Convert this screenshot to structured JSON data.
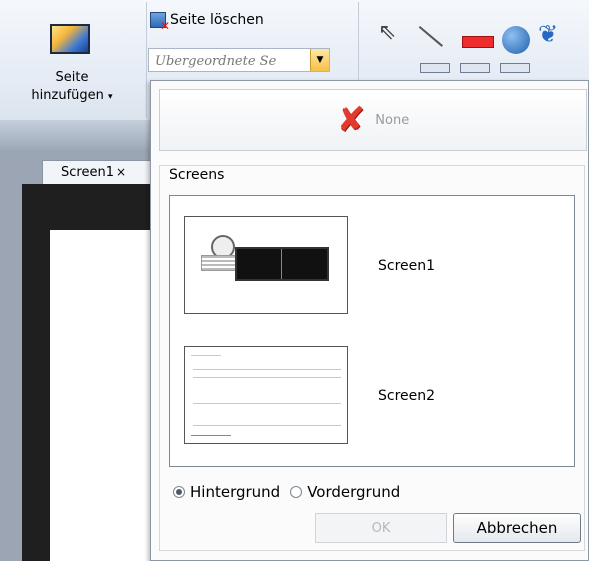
{
  "ribbon": {
    "add_page_line1": "Seite",
    "add_page_line2": "hinzufügen",
    "add_page_caret": "▾",
    "delete_page_label": "Seite löschen",
    "parent_page_value": "Übergeordnete Se"
  },
  "document": {
    "tab_label": "Screen1",
    "tab_close": "×"
  },
  "panel": {
    "none_label": "None",
    "group_label": "Screens",
    "screens": [
      {
        "name": "Screen1"
      },
      {
        "name": "Screen2"
      }
    ],
    "layer_options": [
      {
        "label": "Hintergrund",
        "selected": true
      },
      {
        "label": "Vordergrund",
        "selected": false
      }
    ],
    "ok_label": "OK",
    "cancel_label": "Abbrechen"
  }
}
